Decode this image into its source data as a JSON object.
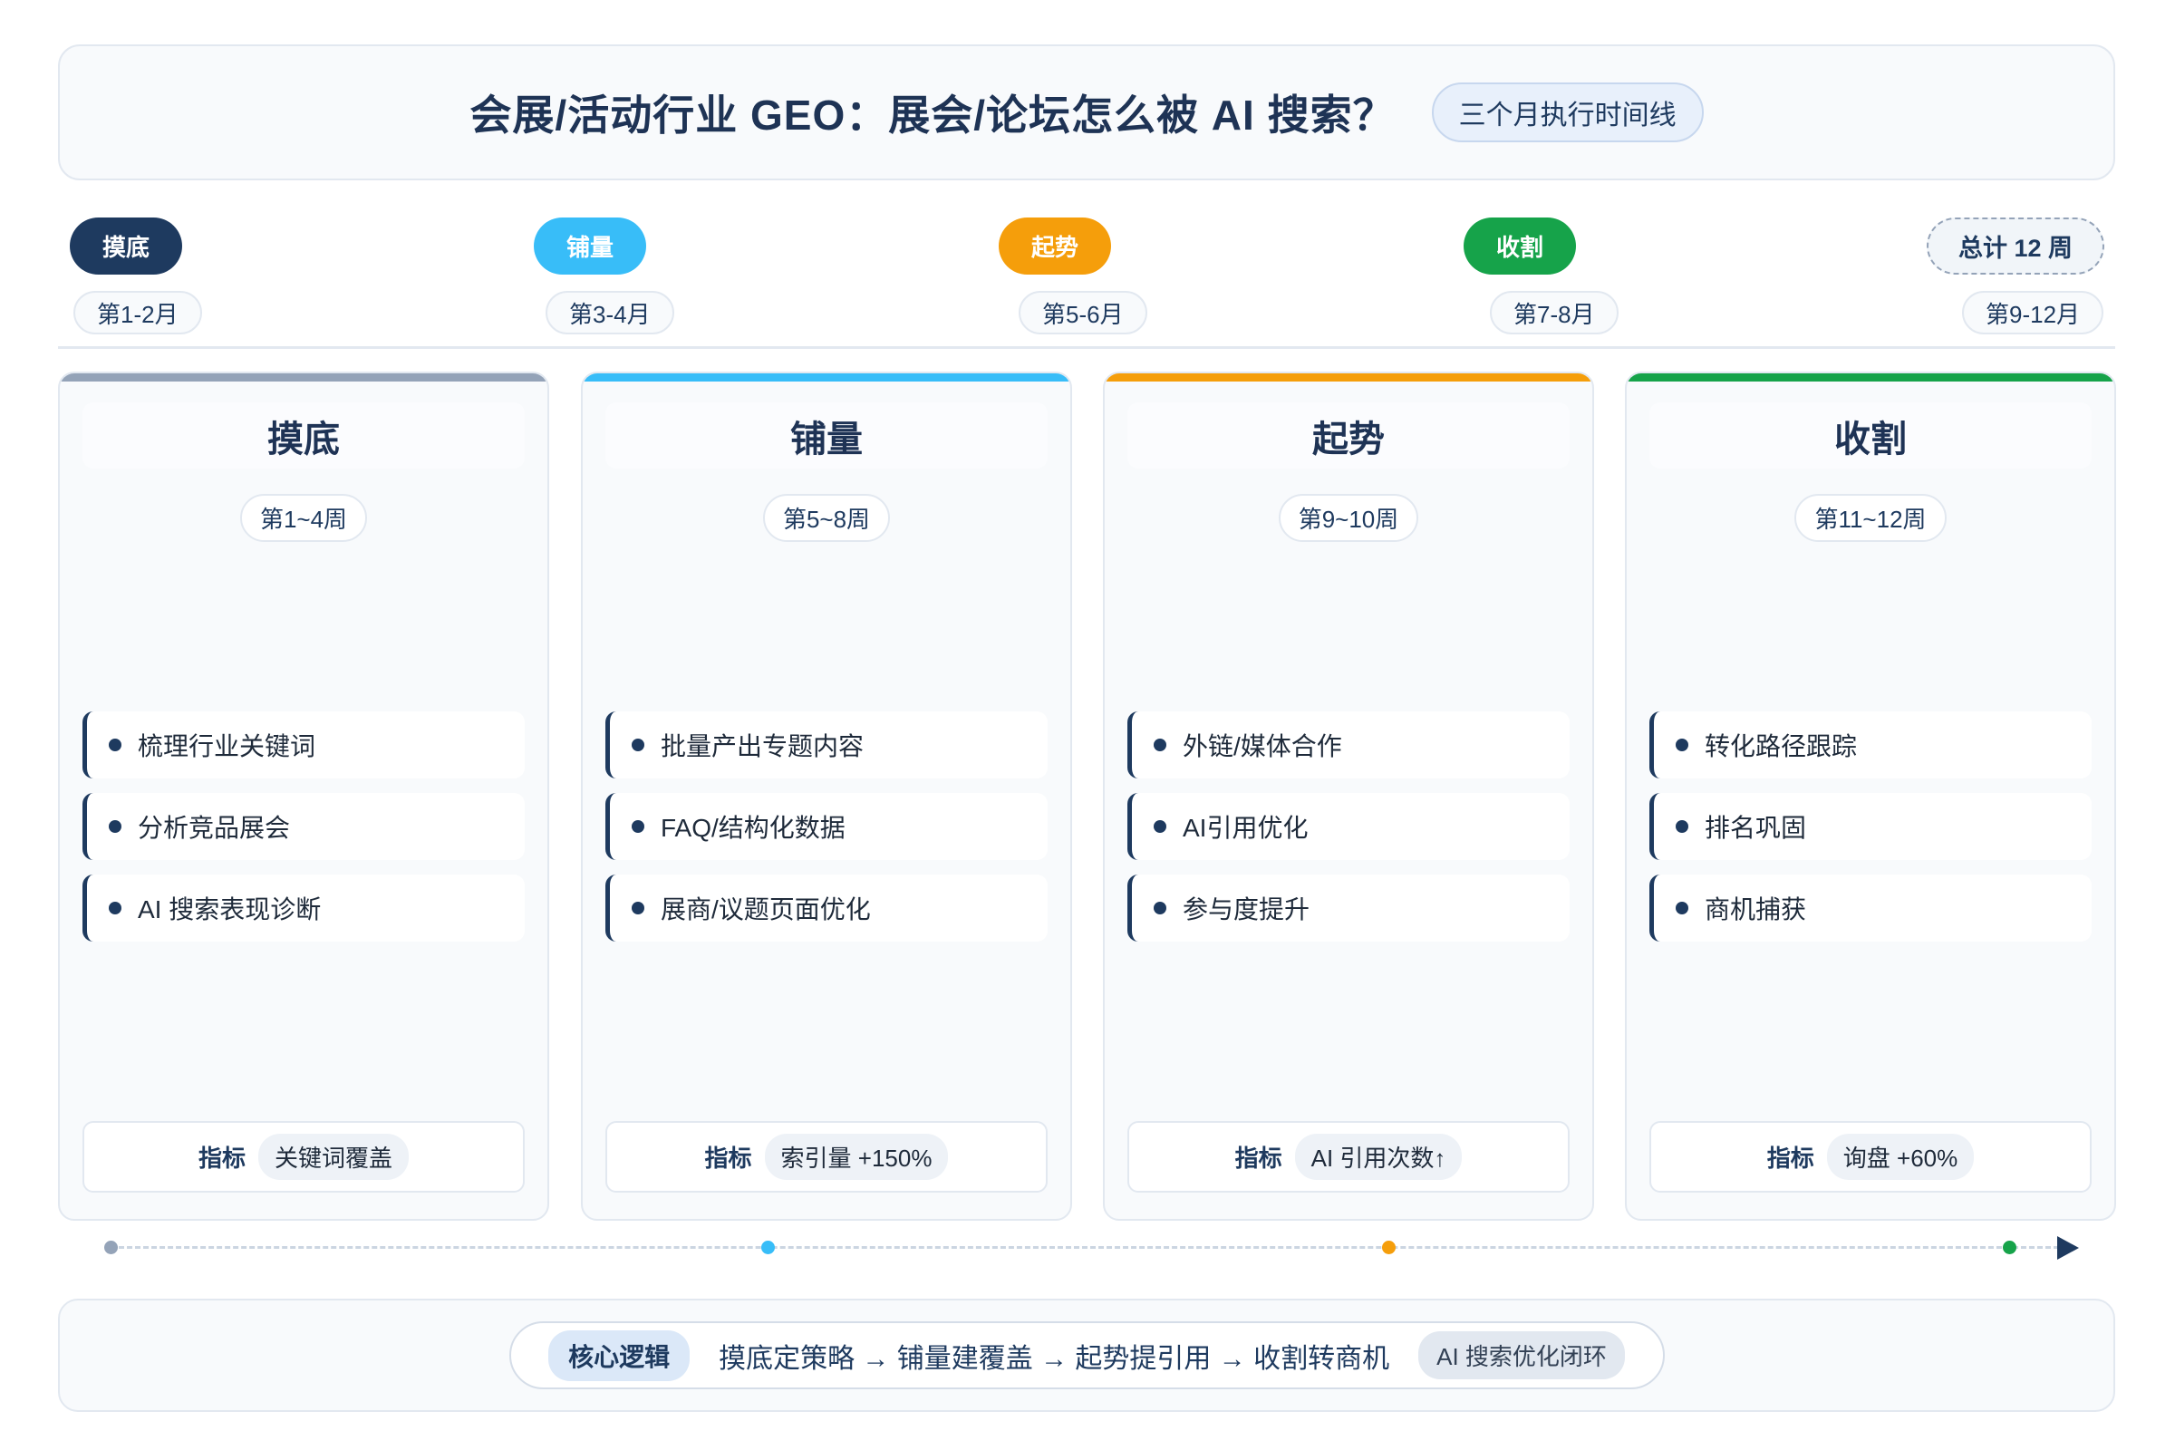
{
  "header": {
    "title": "会展/活动行业 GEO：展会/论坛怎么被 AI 搜索？",
    "badge": "三个月执行时间线"
  },
  "timeline": {
    "stages": [
      {
        "label": "摸底",
        "months": "第1-2月",
        "color": "#1e3a5f"
      },
      {
        "label": "铺量",
        "months": "第3-4月",
        "color": "#38bdf8"
      },
      {
        "label": "起势",
        "months": "第5-6月",
        "color": "#f59e0b"
      },
      {
        "label": "收割",
        "months": "第7-8月",
        "color": "#16a34a"
      }
    ],
    "total": {
      "label": "总计 12 周",
      "months": "第9-12月"
    }
  },
  "cards": [
    {
      "title": "摸底",
      "weeks": "第1~4周",
      "bar_color": "#94a3b8",
      "items": [
        "梳理行业关键词",
        "分析竞品展会",
        "AI 搜索表现诊断"
      ],
      "metric_label": "指标",
      "metric_value": "关键词覆盖"
    },
    {
      "title": "铺量",
      "weeks": "第5~8周",
      "bar_color": "#38bdf8",
      "items": [
        "批量产出专题内容",
        "FAQ/结构化数据",
        "展商/议题页面优化"
      ],
      "metric_label": "指标",
      "metric_value": "索引量 +150%"
    },
    {
      "title": "起势",
      "weeks": "第9~10周",
      "bar_color": "#f59e0b",
      "items": [
        "外链/媒体合作",
        "AI引用优化",
        "参与度提升"
      ],
      "metric_label": "指标",
      "metric_value": "AI 引用次数↑"
    },
    {
      "title": "收割",
      "weeks": "第11~12周",
      "bar_color": "#16a34a",
      "items": [
        "转化路径跟踪",
        "排名巩固",
        "商机捕获"
      ],
      "metric_label": "指标",
      "metric_value": "询盘 +60%"
    }
  ],
  "progress": {
    "dot_colors": [
      "#94a3b8",
      "#38bdf8",
      "#f59e0b",
      "#16a34a"
    ],
    "arrow_color": "#1e3a5f"
  },
  "footer": {
    "label": "核心逻辑",
    "flow": "摸底定策略 → 铺量建覆盖 → 起势提引用 → 收割转商机",
    "tag": "AI 搜索优化闭环"
  },
  "colors": {
    "navy": "#1e3a5f",
    "border": "#e2e8f0",
    "panel": "#f8fafc"
  }
}
